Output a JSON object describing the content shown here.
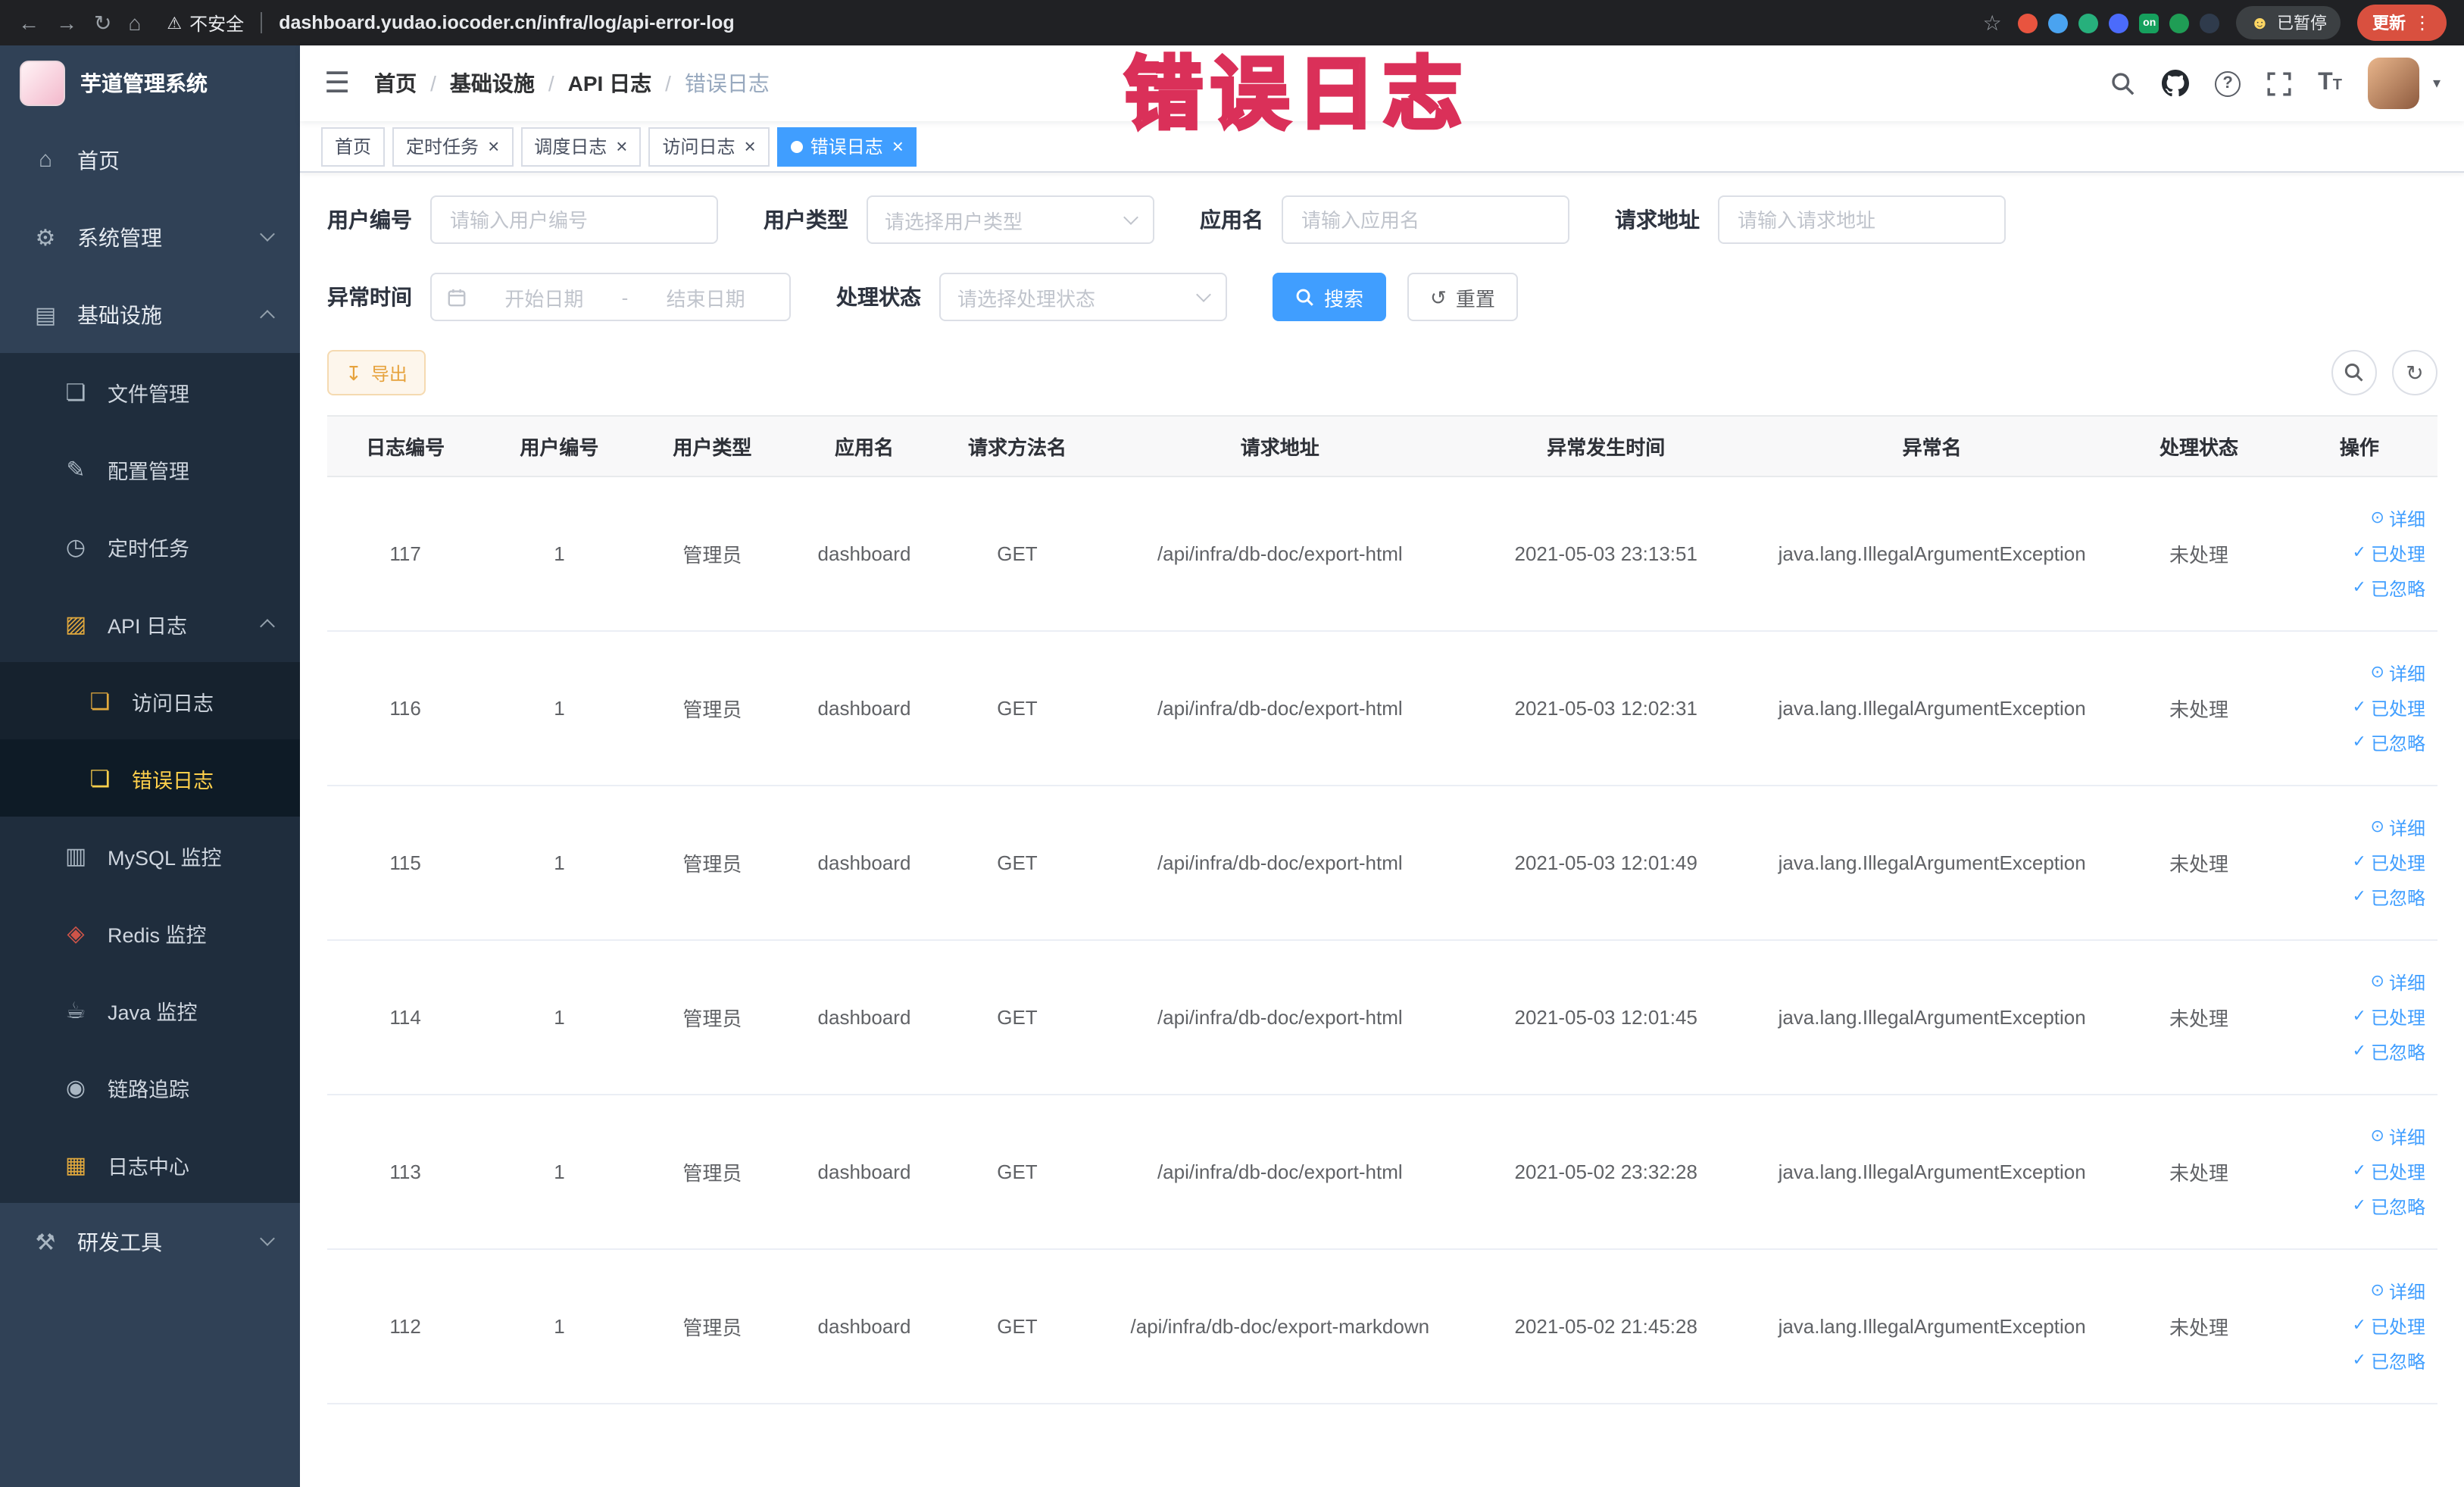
{
  "browser": {
    "security": "不安全",
    "url": "dashboard.yudao.iocoder.cn/infra/log/api-error-log",
    "paused_label": "已暂停",
    "update_label": "更新",
    "extensions": [
      {
        "color": "#e8543f"
      },
      {
        "color": "#4aa3f0"
      },
      {
        "color": "#27b07c"
      },
      {
        "color": "#4b6bfb"
      },
      {
        "color": "#16a05d",
        "label": "on",
        "shape": "square"
      },
      {
        "color": "#1f9d55"
      },
      {
        "color": "#2f3b4c"
      }
    ]
  },
  "annotation": {
    "text": "错误日志"
  },
  "sidebar": {
    "title": "芋道管理系统",
    "menu": [
      {
        "label": "首页"
      },
      {
        "label": "系统管理"
      },
      {
        "label": "基础设施"
      },
      {
        "label": "文件管理"
      },
      {
        "label": "配置管理"
      },
      {
        "label": "定时任务"
      },
      {
        "label": "API 日志"
      },
      {
        "label": "访问日志"
      },
      {
        "label": "错误日志"
      },
      {
        "label": "MySQL 监控"
      },
      {
        "label": "Redis 监控"
      },
      {
        "label": "Java 监控"
      },
      {
        "label": "链路追踪"
      },
      {
        "label": "日志中心"
      },
      {
        "label": "研发工具"
      }
    ]
  },
  "breadcrumb": {
    "items": [
      "首页",
      "基础设施",
      "API 日志",
      "错误日志"
    ]
  },
  "tabs": [
    {
      "label": "首页"
    },
    {
      "label": "定时任务"
    },
    {
      "label": "调度日志"
    },
    {
      "label": "访问日志"
    },
    {
      "label": "错误日志"
    }
  ],
  "filters": {
    "user_id_label": "用户编号",
    "user_id_placeholder": "请输入用户编号",
    "user_type_label": "用户类型",
    "user_type_placeholder": "请选择用户类型",
    "app_name_label": "应用名",
    "app_name_placeholder": "请输入应用名",
    "request_url_label": "请求地址",
    "request_url_placeholder": "请输入请求地址",
    "exception_time_label": "异常时间",
    "date_start_placeholder": "开始日期",
    "date_separator": "-",
    "date_end_placeholder": "结束日期",
    "process_status_label": "处理状态",
    "process_status_placeholder": "请选择处理状态",
    "search_label": "搜索",
    "reset_label": "重置"
  },
  "toolbar": {
    "export_label": "导出"
  },
  "table": {
    "columns": [
      "日志编号",
      "用户编号",
      "用户类型",
      "应用名",
      "请求方法名",
      "请求地址",
      "异常发生时间",
      "异常名",
      "处理状态",
      "操作"
    ],
    "rows": [
      [
        "117",
        "1",
        "管理员",
        "dashboard",
        "GET",
        "/api/infra/db-doc/export-html",
        "2021-05-03 23:13:51",
        "java.lang.IllegalArgumentException",
        "未处理"
      ],
      [
        "116",
        "1",
        "管理员",
        "dashboard",
        "GET",
        "/api/infra/db-doc/export-html",
        "2021-05-03 12:02:31",
        "java.lang.IllegalArgumentException",
        "未处理"
      ],
      [
        "115",
        "1",
        "管理员",
        "dashboard",
        "GET",
        "/api/infra/db-doc/export-html",
        "2021-05-03 12:01:49",
        "java.lang.IllegalArgumentException",
        "未处理"
      ],
      [
        "114",
        "1",
        "管理员",
        "dashboard",
        "GET",
        "/api/infra/db-doc/export-html",
        "2021-05-03 12:01:45",
        "java.lang.IllegalArgumentException",
        "未处理"
      ],
      [
        "113",
        "1",
        "管理员",
        "dashboard",
        "GET",
        "/api/infra/db-doc/export-html",
        "2021-05-02 23:32:28",
        "java.lang.IllegalArgumentException",
        "未处理"
      ],
      [
        "112",
        "1",
        "管理员",
        "dashboard",
        "GET",
        "/api/infra/db-doc/export-markdown",
        "2021-05-02 21:45:28",
        "java.lang.IllegalArgumentException",
        "未处理"
      ]
    ],
    "row_actions": [
      "详细",
      "已处理",
      "已忽略"
    ]
  },
  "icons": {
    "home": "⌂",
    "system": "⚙",
    "infra": "▤",
    "file": "❏",
    "config": "✎",
    "cron": "◷",
    "apilog": "▨",
    "accesslog": "❏",
    "errorlog": "❏",
    "mysql": "▥",
    "redis": "◈",
    "java": "☕",
    "trace": "◉",
    "logcenter": "▦",
    "devtools": "⚒",
    "back": "←",
    "forward": "→",
    "reload": "↻",
    "home_browser": "⌂",
    "warning": "⚠",
    "star": "☆",
    "smiley": "☻",
    "kebab": "⋮",
    "hamburger": "☰",
    "caret_down": "▾",
    "reset": "↺",
    "refresh": "↻",
    "export": "↧",
    "eye": "⊙",
    "check": "✓"
  },
  "colors": {
    "accent": "#409eff",
    "active_tab": "#409eff",
    "warning": "#e6a23c",
    "sidebar_bg": "#304156",
    "sidebar_active_text": "#ffd04b",
    "annotation": "#f4647f"
  }
}
